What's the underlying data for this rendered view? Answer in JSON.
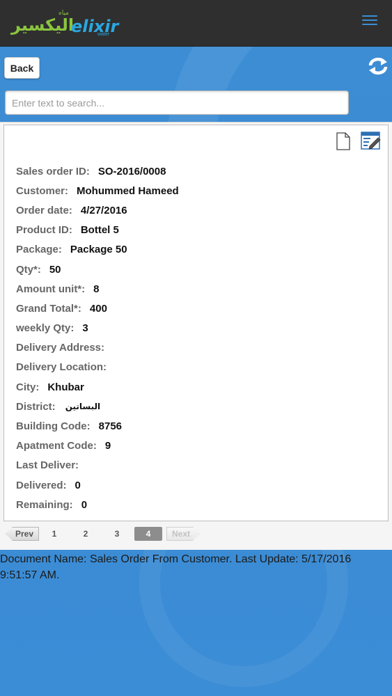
{
  "header": {
    "logo_arabic": "اليكسير",
    "logo_arabic_small": "مياه",
    "logo_english": "elixir",
    "logo_sub": "water",
    "menu_icon": "hamburger-menu-icon"
  },
  "toolbar": {
    "back_label": "Back",
    "refresh_icon": "refresh-icon"
  },
  "search": {
    "placeholder": "Enter text to search..."
  },
  "card": {
    "icons": [
      "document-icon",
      "edit-form-icon"
    ],
    "fields": [
      {
        "label": "Sales order ID:",
        "value": "SO-2016/0008"
      },
      {
        "label": "Customer:",
        "value": "Mohummed Hameed"
      },
      {
        "label": "Order date:",
        "value": "4/27/2016"
      },
      {
        "label": "Product ID:",
        "value": "Bottel 5"
      },
      {
        "label": "Package:",
        "value": "Package 50"
      },
      {
        "label": "Qty*:",
        "value": "50"
      },
      {
        "label": "Amount unit*:",
        "value": "8"
      },
      {
        "label": "Grand Total*:",
        "value": "400"
      },
      {
        "label": "weekly Qty:",
        "value": "3"
      },
      {
        "label": "Delivery Address:",
        "value": ""
      },
      {
        "label": "Delivery Location:",
        "value": ""
      },
      {
        "label": "City:",
        "value": "Khubar"
      },
      {
        "label": "District:",
        "value": "البساتين"
      },
      {
        "label": "Building Code:",
        "value": "8756"
      },
      {
        "label": "Apatment Code:",
        "value": "9"
      },
      {
        "label": "Last Deliver:",
        "value": ""
      },
      {
        "label": "Delivered:",
        "value": "0"
      },
      {
        "label": "Remaining:",
        "value": "0"
      }
    ]
  },
  "pager": {
    "prev_label": "Prev",
    "next_label": "Next",
    "pages": [
      "1",
      "2",
      "3",
      "4"
    ],
    "current_page": "4"
  },
  "footer": {
    "doc_info": "Document Name: Sales Order From Customer. Last Update: 5/17/2016 9:51:57 AM."
  },
  "colors": {
    "background": "#3b8dd6",
    "topbar": "#2f2f2f",
    "logo_green": "#8bc53f",
    "logo_blue": "#2aa7e0"
  }
}
